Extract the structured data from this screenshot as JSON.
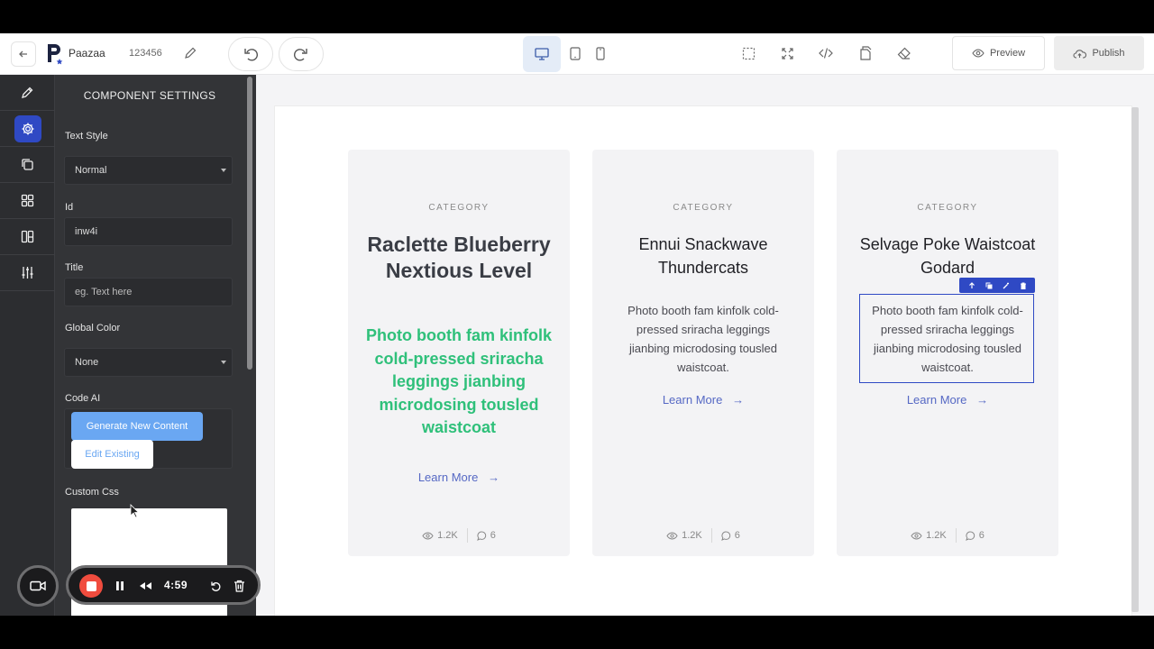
{
  "topbar": {
    "brand": "Paazaa",
    "project_id": "123456",
    "preview_label": "Preview",
    "publish_label": "Publish"
  },
  "panel": {
    "title": "COMPONENT SETTINGS",
    "text_style_label": "Text Style",
    "text_style_value": "Normal",
    "id_label": "Id",
    "id_value": "inw4i",
    "title_label": "Title",
    "title_placeholder": "eg. Text here",
    "global_color_label": "Global Color",
    "global_color_value": "None",
    "code_ai_label": "Code AI",
    "generate_label": "Generate New Content",
    "edit_existing_label": "Edit Existing",
    "custom_css_label": "Custom Css"
  },
  "recorder": {
    "time": "4:59"
  },
  "cards": [
    {
      "category": "CATEGORY",
      "title": "Raclette Blueberry Nextious Level",
      "description": "Photo booth fam kinfolk cold-pressed sriracha leggings jianbing microdosing tousled waistcoat",
      "link": "Learn More",
      "views": "1.2K",
      "comments": "6"
    },
    {
      "category": "CATEGORY",
      "title": "Ennui Snackwave Thundercats",
      "description": "Photo booth fam kinfolk cold-pressed sriracha leggings jianbing microdosing tousled waistcoat.",
      "link": "Learn More",
      "views": "1.2K",
      "comments": "6"
    },
    {
      "category": "CATEGORY",
      "title": "Selvage Poke Waistcoat Godard",
      "description": "Photo booth fam kinfolk cold-pressed sriracha leggings jianbing microdosing tousled waistcoat.",
      "link": "Learn More",
      "views": "1.2K",
      "comments": "6"
    }
  ],
  "colors": {
    "accent": "#2f49c4",
    "highlight_text": "#2fc07a",
    "link": "#5568c4",
    "panel_bg": "#333437",
    "generate_btn": "#6aa7f2",
    "record": "#f04c3e"
  },
  "icons": {
    "rail": [
      "pencil-icon",
      "gear-icon",
      "copy-icon",
      "grid-icon",
      "layout-icon",
      "sliders-icon"
    ],
    "toolbar": [
      "select-icon",
      "fullscreen-icon",
      "code-icon",
      "export-icon",
      "eraser-icon"
    ]
  }
}
